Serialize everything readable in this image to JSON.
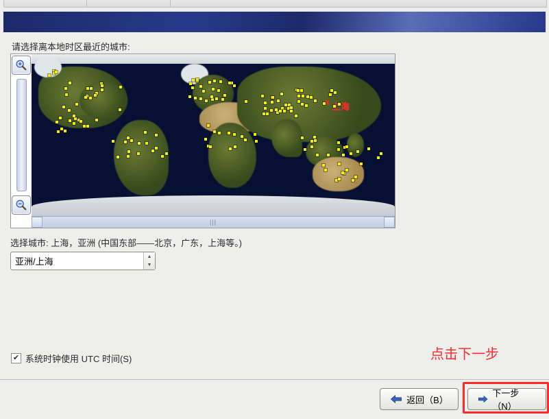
{
  "prompt": "请选择离本地时区最近的城市:",
  "map": {
    "selected_city_label": "上海",
    "selected_marker": "x"
  },
  "selected_city_line": "选择城市: 上海，亚洲 (中国东部——北京，广东，上海等。)",
  "timezone_combo": {
    "value": "亚洲/上海"
  },
  "utc_checkbox": {
    "checked": true,
    "label": "系统时钟使用 UTC 时间(S)"
  },
  "annotation": "点击下一步",
  "buttons": {
    "back": "返回（B）",
    "next": "下一步（N）"
  },
  "icons": {
    "zoom_in": "zoom-in-icon",
    "zoom_out": "zoom-out-icon",
    "arrow_left": "arrow-left-icon",
    "arrow_right": "arrow-right-icon"
  }
}
